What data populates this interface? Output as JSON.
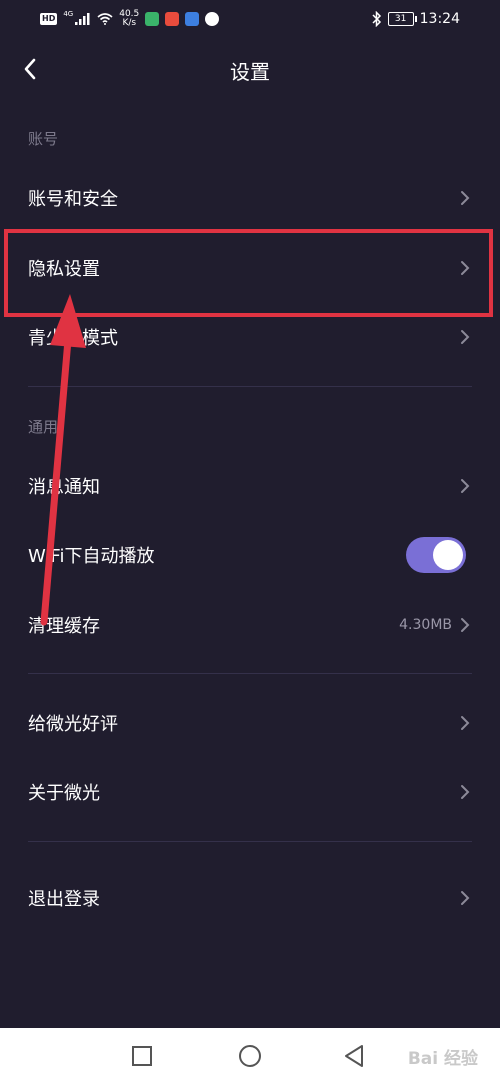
{
  "status_bar": {
    "hd": "HD",
    "net": "4G",
    "speed_value": "40.5",
    "speed_unit": "K/s",
    "battery": "31",
    "time": "13:24",
    "app_icon_colors": [
      "#3ab36a",
      "#e84c3d",
      "#3d7fe0",
      "#ffffff"
    ]
  },
  "header": {
    "title": "设置",
    "back_icon": "chevron-left-icon"
  },
  "sections": {
    "account": {
      "label": "账号"
    },
    "general": {
      "label": "通用"
    }
  },
  "items": {
    "account_security": {
      "label": "账号和安全"
    },
    "privacy": {
      "label": "隐私设置"
    },
    "youth_mode": {
      "label": "青少年模式"
    },
    "notifications": {
      "label": "消息通知"
    },
    "wifi_autoplay": {
      "label": "WiFi下自动播放",
      "enabled": true
    },
    "clear_cache": {
      "label": "清理缓存",
      "value": "4.30MB"
    },
    "rate_app": {
      "label": "给微光好评"
    },
    "about": {
      "label": "关于微光"
    },
    "logout": {
      "label": "退出登录"
    }
  },
  "colors": {
    "background": "#201d2e",
    "toggle_on": "#7a6fd6",
    "annotation": "#e03342",
    "secondary_text": "#7d7a8c"
  },
  "nav_bar": {
    "watermark": "Bai 经验"
  }
}
